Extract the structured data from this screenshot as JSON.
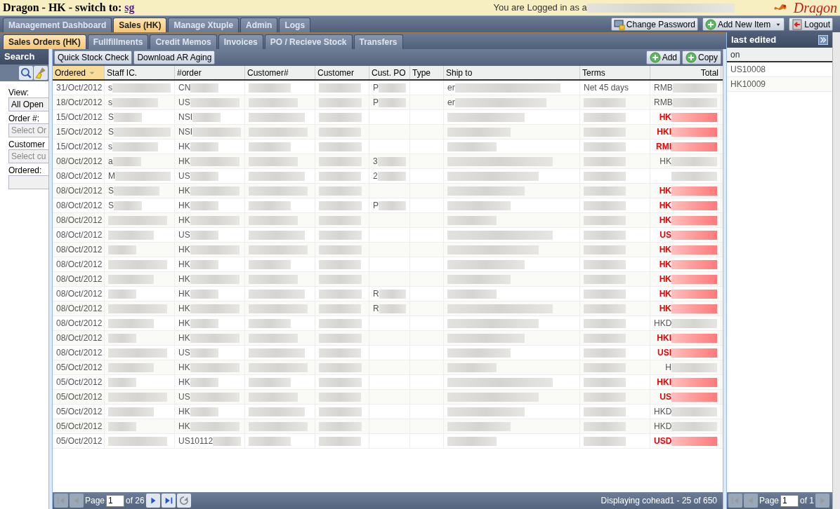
{
  "header": {
    "title": "Dragon - HK - switch to:",
    "switch_link": "sg",
    "login_text": "You are Logged in as a",
    "logo": "Dragon"
  },
  "main_tabs": [
    {
      "label": "Management Dashboard",
      "selected": false
    },
    {
      "label": "Sales (HK)",
      "selected": true
    },
    {
      "label": "Manage Xtuple",
      "selected": false
    },
    {
      "label": "Admin",
      "selected": false
    },
    {
      "label": "Logs",
      "selected": false
    }
  ],
  "top_buttons": [
    {
      "label": "Change Password",
      "kind": "password"
    },
    {
      "label": "Add New Item",
      "kind": "add",
      "dropdown": true
    },
    {
      "label": "Logout",
      "kind": "logout"
    }
  ],
  "sub_tabs": [
    {
      "label": "Sales Orders (HK)",
      "selected": true
    },
    {
      "label": "Fullfillments",
      "selected": false
    },
    {
      "label": "Credit Memos",
      "selected": false
    },
    {
      "label": "Invoices",
      "selected": false
    },
    {
      "label": "PO / Recieve Stock",
      "selected": false
    },
    {
      "label": "Transfers",
      "selected": false
    }
  ],
  "search_panel": {
    "title": "Search",
    "fields": [
      {
        "label": "View:",
        "value": "All Open"
      },
      {
        "label": "Order #:",
        "placeholder": "Select Or"
      },
      {
        "label": "Customer",
        "placeholder": "Select cu"
      },
      {
        "label": "Ordered:"
      }
    ]
  },
  "toolbar": {
    "left": [
      "Quick Stock Check",
      "Download AR Aging"
    ],
    "right": [
      "Add",
      "Copy"
    ]
  },
  "table": {
    "columns": [
      {
        "label": "Ordered",
        "sorted": true
      },
      {
        "label": "Staff IC.",
        "sorted": false
      },
      {
        "label": "#order",
        "sorted": false
      },
      {
        "label": "Customer#",
        "sorted": false
      },
      {
        "label": "Customer",
        "sorted": false
      },
      {
        "label": "Cust. PO",
        "sorted": false
      },
      {
        "label": "Type",
        "sorted": false
      },
      {
        "label": "Ship to",
        "sorted": false
      },
      {
        "label": "Terms",
        "sorted": false
      },
      {
        "label": "Total",
        "sorted": false
      }
    ],
    "rows": [
      {
        "ordered": "31/Oct/2012",
        "staff": "s",
        "order": "CN",
        "cust_po": "P",
        "ship_to": "er",
        "terms": "Net 45 days",
        "total": "RMB",
        "overdue": false
      },
      {
        "ordered": "18/Oct/2012",
        "staff": "s",
        "order": "US",
        "cust_po": "P",
        "ship_to": "er",
        "total": "RMB",
        "overdue": false
      },
      {
        "ordered": "15/Oct/2012",
        "staff": "S",
        "order": "NSI",
        "total": "HK",
        "overdue": true
      },
      {
        "ordered": "15/Oct/2012",
        "staff": "S",
        "order": "NSI",
        "total": "HKI",
        "overdue": true
      },
      {
        "ordered": "15/Oct/2012",
        "staff": "s",
        "order": "HK",
        "total": "RMI",
        "overdue": true
      },
      {
        "ordered": "08/Oct/2012",
        "staff": "a",
        "order": "HK",
        "cust_po": "3",
        "total": "HK",
        "overdue": false
      },
      {
        "ordered": "08/Oct/2012",
        "staff": "M",
        "order": "US",
        "cust_po": "2",
        "overdue": false
      },
      {
        "ordered": "08/Oct/2012",
        "staff": "S",
        "order": "HK",
        "total": "HK",
        "overdue": true
      },
      {
        "ordered": "08/Oct/2012",
        "staff": "S",
        "order": "HK",
        "cust_po": "P",
        "total": "HK",
        "overdue": true
      },
      {
        "ordered": "08/Oct/2012",
        "order": "HK",
        "total": "HK",
        "overdue": true
      },
      {
        "ordered": "08/Oct/2012",
        "order": "US",
        "total": "US",
        "overdue": true
      },
      {
        "ordered": "08/Oct/2012",
        "order": "HK",
        "total": "HK",
        "overdue": true
      },
      {
        "ordered": "08/Oct/2012",
        "order": "HK",
        "total": "HK",
        "overdue": true
      },
      {
        "ordered": "08/Oct/2012",
        "order": "HK",
        "total": "HK",
        "overdue": true
      },
      {
        "ordered": "08/Oct/2012",
        "order": "HK",
        "cust_po": "R",
        "total": "HK",
        "overdue": true
      },
      {
        "ordered": "08/Oct/2012",
        "order": "HK",
        "cust_po": "R",
        "total": "HK",
        "overdue": true
      },
      {
        "ordered": "08/Oct/2012",
        "order": "HK",
        "total": "HKD",
        "overdue": false
      },
      {
        "ordered": "08/Oct/2012",
        "order": "HK",
        "total": "HKI",
        "overdue": true
      },
      {
        "ordered": "08/Oct/2012",
        "order": "US",
        "total": "USI",
        "overdue": true
      },
      {
        "ordered": "05/Oct/2012",
        "order": "HK",
        "total": "H",
        "overdue": false
      },
      {
        "ordered": "05/Oct/2012",
        "order": "HK",
        "total": "HKI",
        "overdue": true
      },
      {
        "ordered": "05/Oct/2012",
        "order": "US",
        "total": "US",
        "overdue": true
      },
      {
        "ordered": "05/Oct/2012",
        "order": "HK",
        "total": "HKD",
        "overdue": false
      },
      {
        "ordered": "05/Oct/2012",
        "order": "HK",
        "total": "HKD",
        "overdue": false
      },
      {
        "ordered": "05/Oct/2012",
        "order": "US10112",
        "total": "USD",
        "overdue": true
      }
    ]
  },
  "pager": {
    "page_label": "Page",
    "page": "1",
    "of": "of 26",
    "display": "Displaying cohead1 - 25 of 650"
  },
  "last_edited": {
    "title": "last edited",
    "column": "on",
    "items": [
      {
        "label": "US10008",
        "selected": false
      },
      {
        "label": "HK10009",
        "selected": false
      }
    ],
    "pager": {
      "page_label": "Page",
      "page": "1",
      "of": "of 1"
    }
  }
}
